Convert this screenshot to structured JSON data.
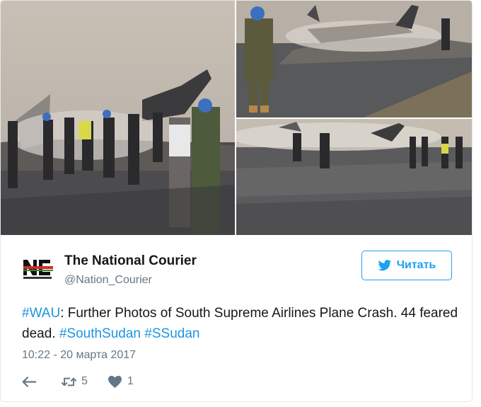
{
  "tweet": {
    "display_name": "The National Courier",
    "handle": "@Nation_Courier",
    "follow_label": "Читать",
    "text_parts": [
      "#WAU",
      ": Further Photos of South Supreme Airlines Plane Crash. 44 feared dead. ",
      "#SouthSudan",
      " ",
      "#SSudan"
    ],
    "timestamp": "10:22 - 20 марта 2017",
    "retweet_count": "5",
    "like_count": "1"
  },
  "icons": {
    "logo": "national-courier-logo",
    "follow": "twitter-bird-icon",
    "reply": "reply-icon",
    "retweet": "retweet-icon",
    "like": "heart-icon"
  },
  "colors": {
    "accent": "#1da1f2",
    "hashtag": "#1b95e0",
    "muted": "#657786",
    "text": "#14171a"
  }
}
